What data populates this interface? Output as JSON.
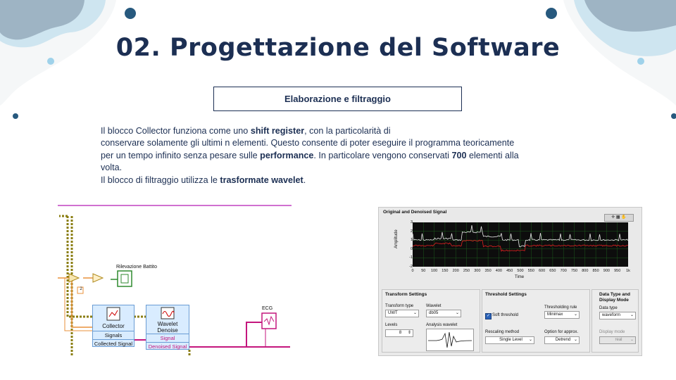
{
  "slide": {
    "title": "02. Progettazione del Software",
    "subtitle": "Elaborazione e filtraggio",
    "paragraphs": {
      "p1_a": "Il blocco Collector funziona come uno ",
      "p1_b": "shift register",
      "p1_c": ", con la particolarità di",
      "p2": "conservare solamente gli ultimi  n elementi. Questo consente di poter eseguire il programma teoricamente",
      "p3_a": "per un tempo infinito senza pesare sulle ",
      "p3_b": "performance",
      "p3_c": ". In particolare vengono conservati ",
      "p3_d": "700",
      "p3_e": " elementi alla",
      "p4": "volta.",
      "p5_a": "Il blocco di filtraggio utilizza  le ",
      "p5_b": "trasformate wavelet",
      "p5_c": "."
    },
    "colors": {
      "navy": "#1c2f53",
      "light_blue": "#9fd2ea",
      "dark_blue": "#27597e"
    }
  },
  "diagram": {
    "rilevazione_label": "Rilevazione Battito",
    "collector": {
      "name": "Collector",
      "term1": "Signals",
      "term2": "Collected Signal"
    },
    "wavelet": {
      "name1": "Wavelet",
      "name2": "Denoise",
      "term1": "Signal",
      "term2": "Denoised Signal"
    },
    "ecg_label": "ECG",
    "const_label": "2"
  },
  "panel": {
    "graph_title": "Original and Denoised Signal",
    "y_label": "Amplitude",
    "x_label": "Time",
    "y_ticks": [
      "3",
      "2",
      "1",
      "0",
      "-1",
      "-2"
    ],
    "x_ticks": [
      "0",
      "50",
      "100",
      "150",
      "200",
      "250",
      "300",
      "350",
      "400",
      "450",
      "500",
      "550",
      "600",
      "650",
      "700",
      "750",
      "800",
      "850",
      "900",
      "950",
      "1k"
    ],
    "transform": {
      "title": "Transform Settings",
      "type_label": "Transform type",
      "type_value": "UWT",
      "wavelet_label": "Wavelet",
      "wavelet_value": "db05",
      "levels_label": "Levels",
      "levels_value": "8",
      "analysis_label": "Analysis wavelet"
    },
    "threshold": {
      "title": "Threshold Settings",
      "soft_label": "Soft threshold",
      "rule_label": "Thresholding rule",
      "rule_value": "Minimax",
      "rescale_label": "Rescaling method",
      "rescale_value": "Single Level",
      "option_label": "Option for approx.",
      "option_value": "Detrend"
    },
    "datatype": {
      "title1": "Data Type and",
      "title2": "Display Mode",
      "type_label": "Data type",
      "type_value": "waveform",
      "mode_label": "Display mode",
      "mode_value": "real"
    }
  }
}
